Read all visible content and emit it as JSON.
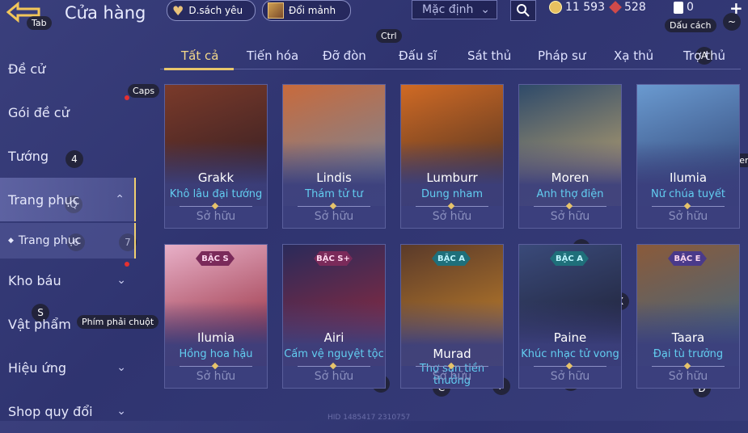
{
  "header": {
    "title": "Cửa hàng",
    "wishlist_label": "D.sách yêu",
    "exchange_label": "Đổi mảnh",
    "sort_value": "Mặc định",
    "gold": "11 593",
    "ruby": "528",
    "vouchers": "0"
  },
  "keys": {
    "tab": "Tab",
    "ctrl": "Ctrl",
    "caps": "Caps",
    "comma": "Dấu cách",
    "tilde": "~",
    "enter": "Enter",
    "right_mouse": "Phím phải chuột",
    "k4": "4",
    "kq": "Q",
    "k6": "6",
    "k7": "7",
    "ks": "S",
    "k3": "3",
    "k2": "2",
    "kx": "X",
    "kb": "B",
    "kc": "C",
    "kf": "F",
    "kz": "Z",
    "kd": "D",
    "ke": "E",
    "ka": "A"
  },
  "sidebar": {
    "items": [
      "Đề cử",
      "Gói đề cử",
      "Tướng",
      "Trang phục",
      "Trang phục",
      "Kho báu",
      "Vật phẩm",
      "Hiệu ứng",
      "Shop quy đổi"
    ]
  },
  "tabs": [
    "Tất cả",
    "Tiến hóa",
    "Đỡ đòn",
    "Đấu sĩ",
    "Sát thủ",
    "Pháp sư",
    "Xạ thủ",
    "Trợ thủ"
  ],
  "cards": [
    {
      "name": "Grakk",
      "skin": "Khô lâu đại tướng",
      "status": "Sở hữu",
      "badge": "",
      "colors": [
        "#7a3a2a",
        "#2a1a22"
      ]
    },
    {
      "name": "Lindis",
      "skin": "Thám tử tư",
      "status": "Sở hữu",
      "badge": "",
      "colors": [
        "#c86a3c",
        "#6a8aa8"
      ]
    },
    {
      "name": "Lumburr",
      "skin": "Dung nham",
      "status": "Sở hữu",
      "badge": "",
      "colors": [
        "#d06a24",
        "#3a2a22"
      ]
    },
    {
      "name": "Moren",
      "skin": "Anh thợ điện",
      "status": "Sở hữu",
      "badge": "",
      "colors": [
        "#2e4a6a",
        "#d0b070"
      ]
    },
    {
      "name": "Ilumia",
      "skin": "Nữ chúa tuyết",
      "status": "Sở hữu",
      "badge": "",
      "colors": [
        "#6a9ad0",
        "#2a3a6a"
      ]
    },
    {
      "name": "Ilumia",
      "skin": "Hồng hoa hậu",
      "status": "Sở hữu",
      "badge": "BẬC S",
      "colors": [
        "#e8b0c8",
        "#8a1a2a"
      ]
    },
    {
      "name": "Airi",
      "skin": "Cấm vệ nguyệt tộc",
      "status": "Sở hữu",
      "badge": "BẬC S+",
      "colors": [
        "#2a2a5a",
        "#a02a3a"
      ]
    },
    {
      "name": "Murad",
      "skin": "Thợ săn tiền thưởng",
      "status": "Sở hữu",
      "badge": "BẬC A",
      "colors": [
        "#5a3a2a",
        "#d08a2a"
      ]
    },
    {
      "name": "Paine",
      "skin": "Khúc nhạc tử vong",
      "status": "Sở hữu",
      "badge": "BẬC A",
      "colors": [
        "#3a4a7a",
        "#1a1a2a"
      ]
    },
    {
      "name": "Taara",
      "skin": "Đại tù trưởng",
      "status": "Sở hữu",
      "badge": "BẬC E",
      "colors": [
        "#8a5a3a",
        "#3a6a8a"
      ]
    }
  ],
  "footer": "HID 1485417 2310757"
}
